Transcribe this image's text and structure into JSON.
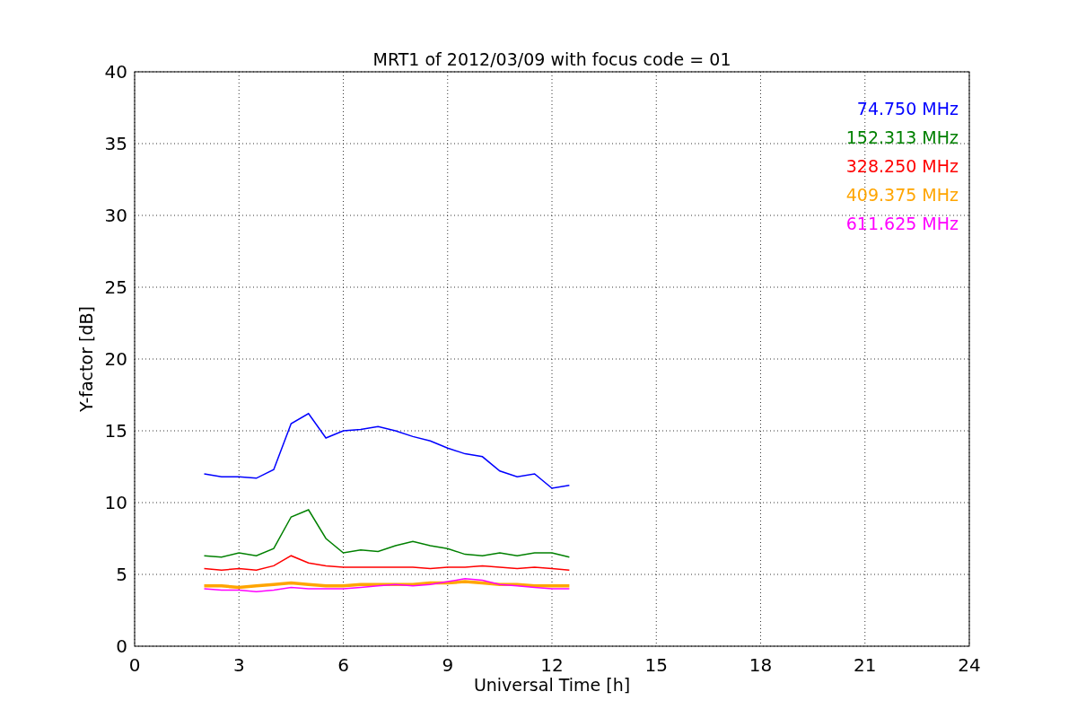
{
  "chart_data": {
    "type": "line",
    "title": "MRT1 of 2012/03/09 with focus code = 01",
    "xlabel": "Universal Time [h]",
    "ylabel": "Y-factor [dB]",
    "x": [
      2,
      2.5,
      3,
      3.5,
      4,
      4.5,
      5,
      5.5,
      6,
      6.5,
      7,
      7.5,
      8,
      8.5,
      9,
      9.5,
      10,
      10.5,
      11,
      11.5,
      12,
      12.5
    ],
    "series": [
      {
        "name": "74.750 MHz",
        "color": "#0000ff",
        "values": [
          12,
          11.8,
          11.8,
          11.7,
          12.3,
          15.5,
          16.2,
          14.5,
          15,
          15.1,
          15.3,
          15,
          14.6,
          14.3,
          13.8,
          13.4,
          13.2,
          12.2,
          11.8,
          12,
          11,
          11.2
        ]
      },
      {
        "name": "152.313 MHz",
        "color": "#008000",
        "values": [
          6.3,
          6.2,
          6.5,
          6.3,
          6.8,
          9,
          9.5,
          7.5,
          6.5,
          6.7,
          6.6,
          7,
          7.3,
          7,
          6.8,
          6.4,
          6.3,
          6.5,
          6.3,
          6.5,
          6.5,
          6.2
        ]
      },
      {
        "name": "328.250 MHz",
        "color": "#ff0000",
        "values": [
          5.4,
          5.3,
          5.4,
          5.3,
          5.6,
          6.3,
          5.8,
          5.6,
          5.5,
          5.5,
          5.5,
          5.5,
          5.5,
          5.4,
          5.5,
          5.5,
          5.6,
          5.5,
          5.4,
          5.5,
          5.4,
          5.3
        ]
      },
      {
        "name": "409.375 MHz",
        "color": "#ffa500",
        "values": [
          4.2,
          4.2,
          4.1,
          4.2,
          4.3,
          4.4,
          4.3,
          4.2,
          4.2,
          4.3,
          4.3,
          4.3,
          4.3,
          4.4,
          4.4,
          4.5,
          4.4,
          4.3,
          4.3,
          4.2,
          4.2,
          4.2
        ]
      },
      {
        "name": "611.625 MHz",
        "color": "#ff00ff",
        "values": [
          4,
          3.9,
          3.9,
          3.8,
          3.9,
          4.1,
          4,
          4,
          4,
          4.1,
          4.2,
          4.3,
          4.2,
          4.3,
          4.5,
          4.7,
          4.6,
          4.3,
          4.2,
          4.1,
          4,
          4
        ]
      }
    ],
    "grid": true,
    "xlim": [
      0,
      24
    ],
    "ylim": [
      0,
      40
    ],
    "xticks": [
      0,
      3,
      6,
      9,
      12,
      15,
      18,
      21,
      24
    ],
    "yticks": [
      0,
      5,
      10,
      15,
      20,
      25,
      30,
      35,
      40
    ]
  }
}
